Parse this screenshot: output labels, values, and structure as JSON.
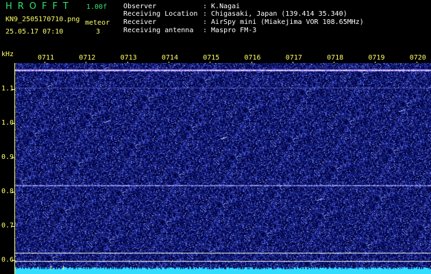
{
  "header": {
    "brand": "HROFFT",
    "version": "1.00f",
    "filename": "KN9_2505170710.png",
    "mode": "meteor",
    "datetime": "25.05.17 07:10",
    "count": "3",
    "info": [
      {
        "label": "Observer",
        "value": ": K.Nagai"
      },
      {
        "label": "Receiving Location",
        "value": ": Chigasaki, Japan (139.414 35.340)"
      },
      {
        "label": "Receiver",
        "value": ": AirSpy mini (Miakejima VOR 108.65MHz)"
      },
      {
        "label": "Receiving antenna",
        "value": ": Maspro FM-3"
      }
    ]
  },
  "axes": {
    "y_unit": "kHz",
    "y_ticks": [
      "1.1",
      "1.0",
      "0.9",
      "0.8",
      "0.7",
      "0.6"
    ],
    "time_ticks": [
      "0711",
      "0712",
      "0713",
      "0714",
      "0715",
      "0716",
      "0717",
      "0718",
      "0719",
      "0720"
    ]
  },
  "colors": {
    "background": "#000000",
    "noise": "#1a1aa0",
    "signal": "#c8c8ff",
    "header_green": "#2ee66a",
    "header_yellow": "#ffff66",
    "level_cyan": "#33ddff"
  }
}
